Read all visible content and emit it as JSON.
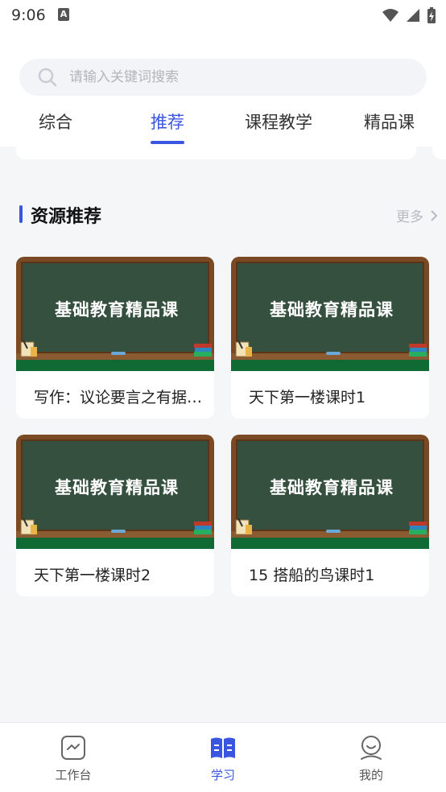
{
  "status_bar": {
    "time": "9:06",
    "notification_glyph": "A"
  },
  "search": {
    "placeholder": "请输入关键词搜索"
  },
  "tabs": [
    {
      "label": "综合",
      "active": false
    },
    {
      "label": "推荐",
      "active": true
    },
    {
      "label": "课程教学",
      "active": false
    },
    {
      "label": "精品课",
      "active": false
    }
  ],
  "section": {
    "title": "资源推荐",
    "more_label": "更多"
  },
  "cards": [
    {
      "thumb_text": "基础教育精品课",
      "title": "写作：议论要言之有据…"
    },
    {
      "thumb_text": "基础教育精品课",
      "title": "天下第一楼课时1"
    },
    {
      "thumb_text": "基础教育精品课",
      "title": "天下第一楼课时2"
    },
    {
      "thumb_text": "基础教育精品课",
      "title": "15 搭船的鸟课时1"
    }
  ],
  "bottom_nav": [
    {
      "label": "工作台",
      "icon": "workbench-icon",
      "active": false
    },
    {
      "label": "学习",
      "icon": "book-icon",
      "active": true
    },
    {
      "label": "我的",
      "icon": "profile-icon",
      "active": false
    }
  ],
  "colors": {
    "accent": "#3a56e0",
    "board": "#36503f",
    "floor": "#0f6b33",
    "frame": "#7a4a25"
  }
}
